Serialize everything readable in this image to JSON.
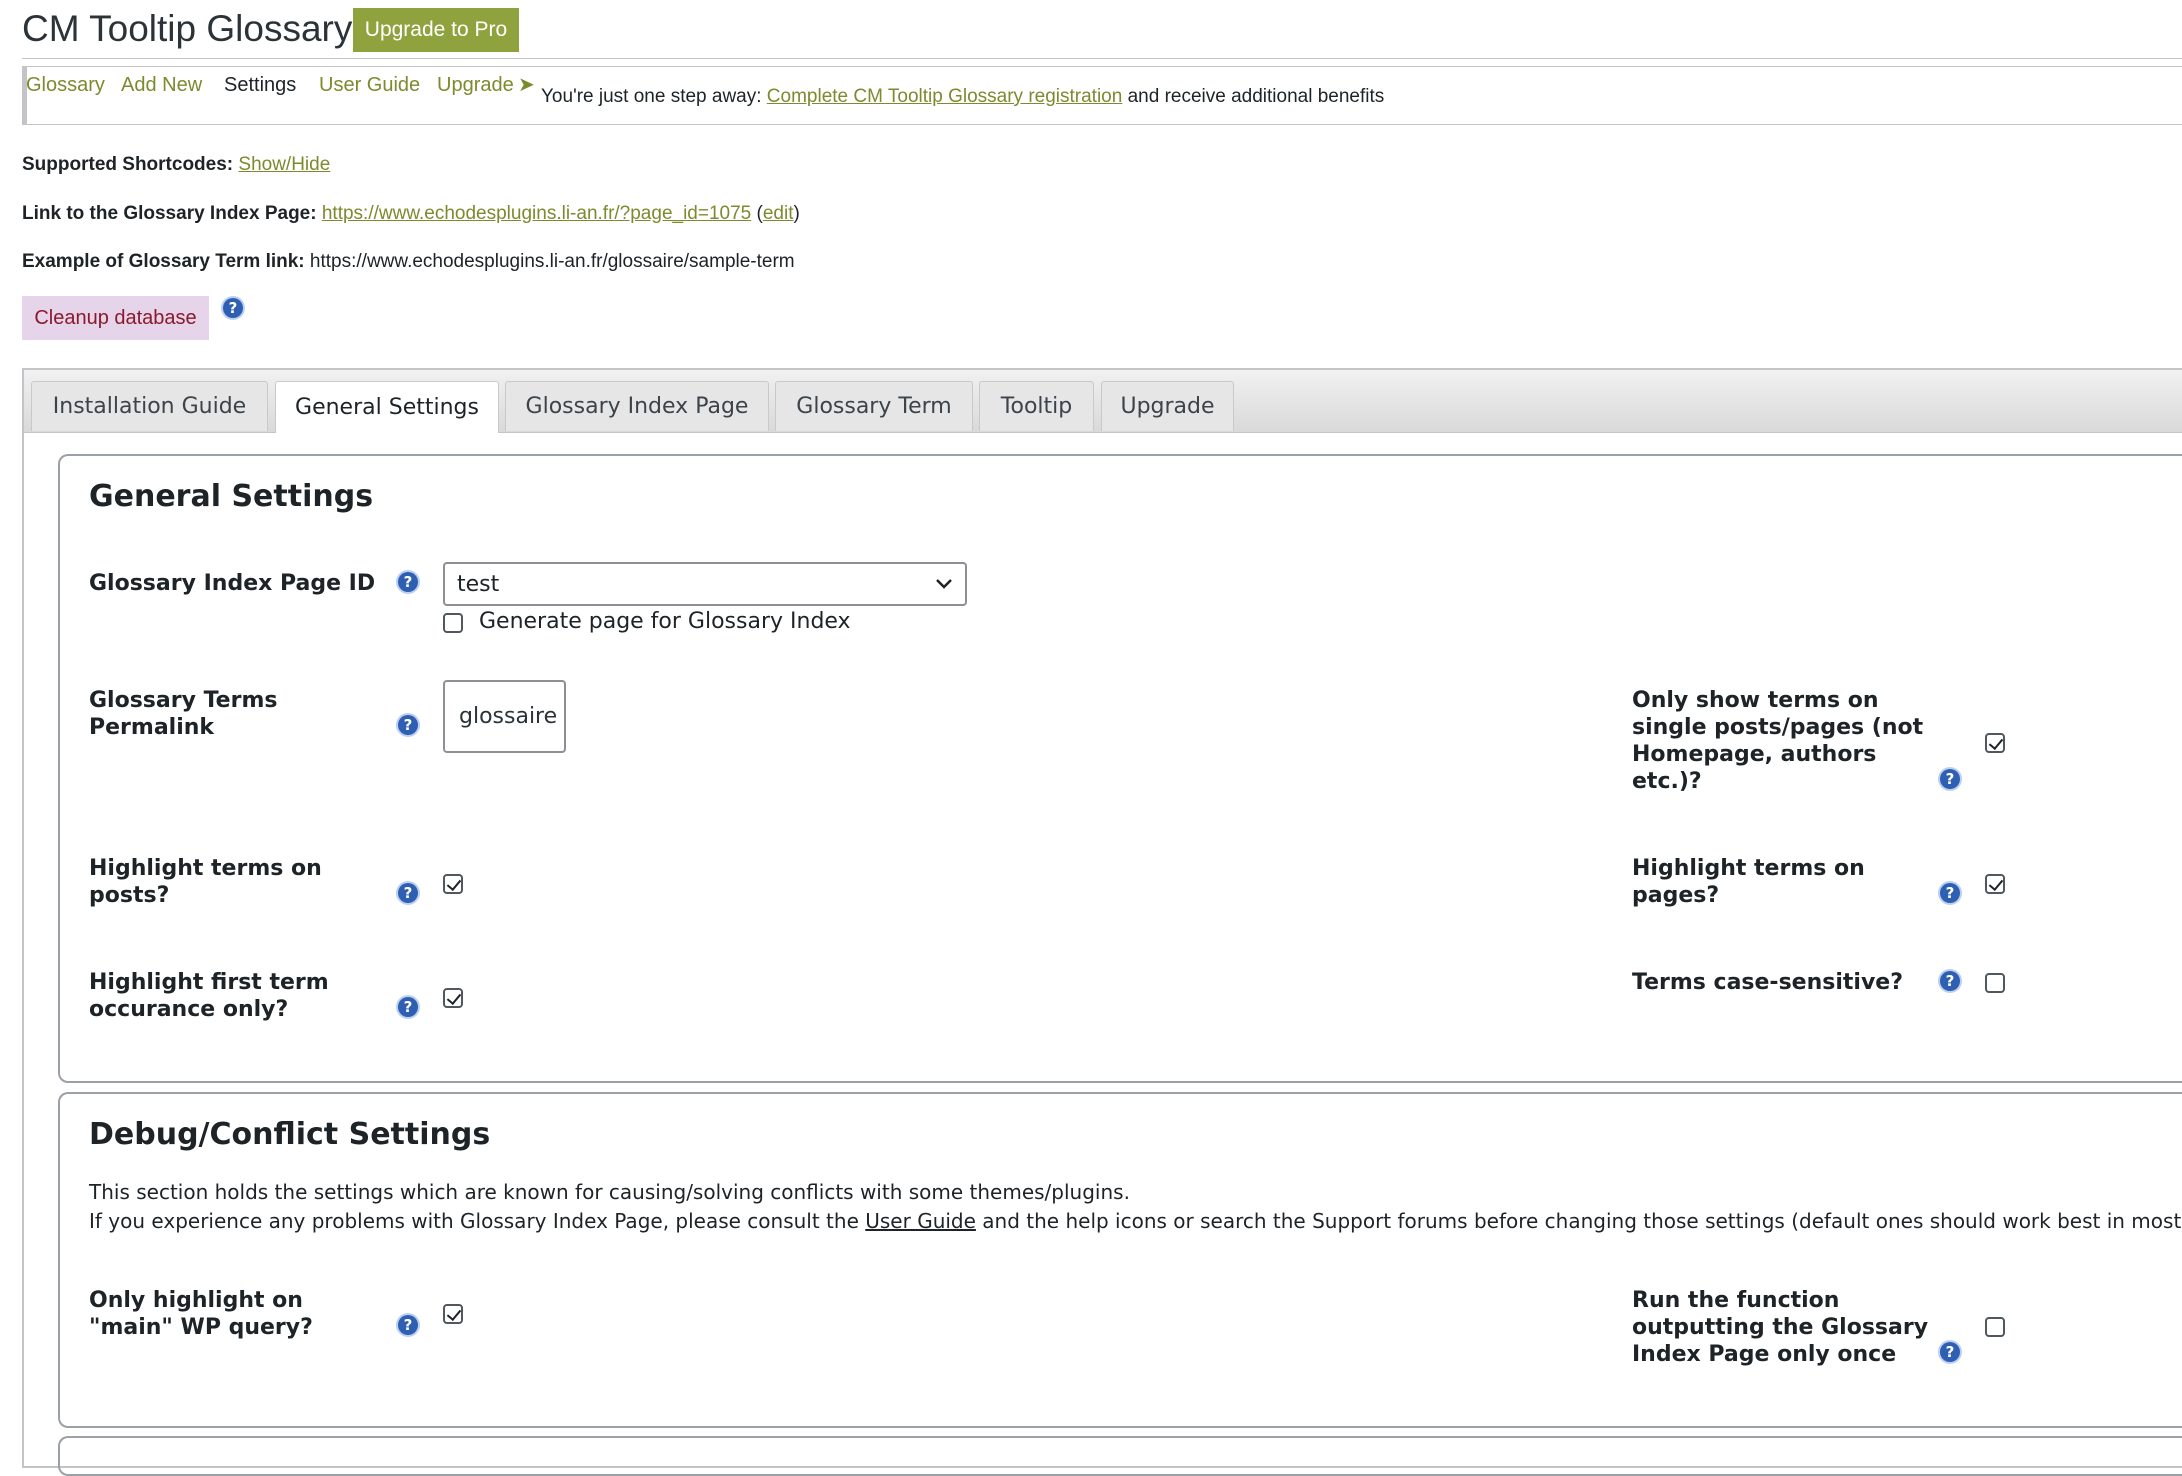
{
  "header": {
    "title": "CM Tooltip Glossary",
    "upgrade_button": "Upgrade to Pro"
  },
  "menu": {
    "items": [
      "Glossary",
      "Add New",
      "Settings",
      "User Guide",
      "Upgrade"
    ],
    "active": "Settings",
    "registration_prefix": "You're just one step away:",
    "registration_link": "Complete CM Tooltip Glossary registration",
    "registration_suffix": "and receive additional benefits"
  },
  "info": {
    "shortcodes_label": "Supported Shortcodes:",
    "shortcodes_link": "Show/Hide",
    "index_page_label": "Link to the Glossary Index Page:",
    "index_page_url": "https://www.echodesplugins.li-an.fr/?page_id=1075",
    "index_page_edit": "edit",
    "term_link_label": "Example of Glossary Term link:",
    "term_link_value": "https://www.echodesplugins.li-an.fr/glossaire/sample-term"
  },
  "cleanup_button": "Cleanup database",
  "tabs": [
    {
      "label": "Installation Guide",
      "active": false
    },
    {
      "label": "General Settings",
      "active": true
    },
    {
      "label": "Glossary Index Page",
      "active": false
    },
    {
      "label": "Glossary Term",
      "active": false
    },
    {
      "label": "Tooltip",
      "active": false
    },
    {
      "label": "Upgrade",
      "active": false
    }
  ],
  "general": {
    "title": "General Settings",
    "index_page_id_label": "Glossary Index Page ID",
    "index_page_id_value": "test",
    "generate_page_label": "Generate page for Glossary Index",
    "generate_page_checked": false,
    "permalink_label": "Glossary Terms Permalink",
    "permalink_value": "glossaire",
    "only_single_label": "Only show terms on single posts/pages (not Homepage, authors etc.)?",
    "only_single_checked": true,
    "highlight_posts_label": "Highlight terms on posts?",
    "highlight_posts_checked": true,
    "highlight_pages_label": "Highlight terms on pages?",
    "highlight_pages_checked": true,
    "highlight_first_label": "Highlight first term occurance only?",
    "highlight_first_checked": true,
    "case_sensitive_label": "Terms case-sensitive?",
    "case_sensitive_checked": false
  },
  "debug": {
    "title": "Debug/Conflict Settings",
    "desc_line1": "This section holds the settings which are known for causing/solving conflicts with some themes/plugins.",
    "desc_line2_prefix": "If you experience any problems with Glossary Index Page, please consult the",
    "desc_line2_link": "User Guide",
    "desc_line2_suffix": "and the help icons or search the Support forums before changing those settings (default ones should work best in most cas",
    "main_query_label": "Only highlight on \"main\" WP query?",
    "main_query_checked": true,
    "run_once_label": "Run the function outputting the Glossary Index Page only once",
    "run_once_checked": false
  },
  "icons": {
    "help": "help-icon",
    "chevron": "chevron-down-icon",
    "arrow": "arrow-right-icon"
  },
  "colors": {
    "accent_green": "#8ea33e",
    "link_green": "#7d8a2e",
    "cleanup_bg": "#e5d4ea",
    "help_blue": "#2f5fb3"
  }
}
